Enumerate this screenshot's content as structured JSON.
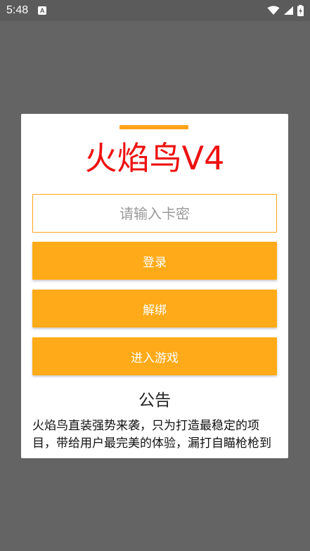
{
  "status_bar": {
    "time": "5:48",
    "notification_letter": "A"
  },
  "dialog": {
    "title": "火焰鸟V4",
    "title_color": "#ee1111",
    "accent_color": "#ffa31a",
    "key_input": {
      "value": "",
      "placeholder": "请输入卡密"
    },
    "buttons": {
      "login": "登录",
      "unbind": "解绑",
      "enter_game": "进入游戏"
    },
    "notice": {
      "title": "公告",
      "body": "火焰鸟直装强势来袭，只为打造最稳定的项目，带给用户最完美的体验，漏打自瞄枪枪到"
    }
  }
}
